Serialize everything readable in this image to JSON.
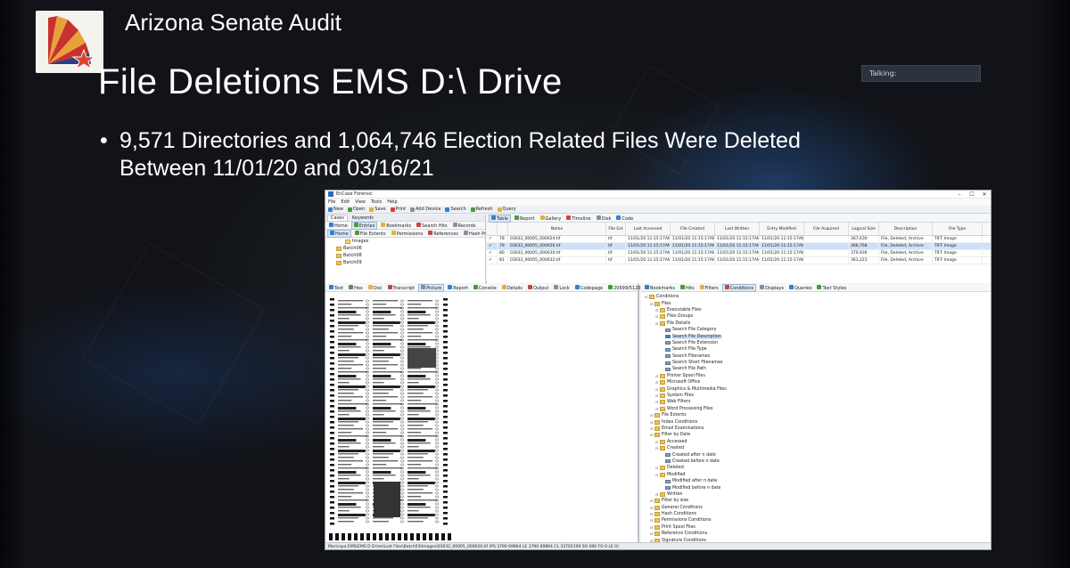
{
  "slide": {
    "org_title": "Arizona Senate Audit",
    "title": "File Deletions EMS D:\\ Drive",
    "bullet_symbol": "•",
    "bullet_line1": "9,571 Directories and 1,064,746 Election Related Files Were Deleted",
    "bullet_line2": "Between 11/01/20 and 03/16/21",
    "talking_label": "Talking:",
    "logo_colors": {
      "red": "#c8312f",
      "gold": "#e8a13a",
      "blue": "#2a3f86",
      "star": "#d9442b"
    }
  },
  "app": {
    "title": "EnCase Forensic",
    "window_controls": [
      "–",
      "☐",
      "✕"
    ],
    "menu": [
      "File",
      "Edit",
      "View",
      "Tools",
      "Help"
    ],
    "toolbar": [
      {
        "label": "New",
        "icon": "new-icon"
      },
      {
        "label": "Open",
        "icon": "open-icon"
      },
      {
        "label": "Save",
        "icon": "save-icon"
      },
      {
        "label": "Print",
        "icon": "print-icon"
      },
      {
        "label": "Add Device",
        "icon": "add-device-icon"
      },
      {
        "label": "Search",
        "icon": "search-icon"
      },
      {
        "label": "Refresh",
        "icon": "refresh-icon"
      },
      {
        "label": "Query",
        "icon": "query-icon"
      }
    ],
    "left_pane": {
      "tabs": [
        "Cases",
        "Keywords"
      ],
      "subtabs": [
        "Home",
        "Entries",
        "Bookmarks",
        "Search Hits",
        "Records"
      ],
      "filter_tabs": [
        "Home",
        "File Extents",
        "Permissions",
        "References",
        "Hash Pr"
      ],
      "tree": [
        "Images",
        "Batch06",
        "Batch08",
        "Batch09"
      ]
    },
    "right_pane": {
      "tabs": [
        "Table",
        "Report",
        "Gallery",
        "Timeline",
        "Disk",
        "Code"
      ],
      "columns": [
        "",
        "",
        "Name",
        "File Ext",
        "Last Accessed",
        "File Created",
        "Last Written",
        "Entry Modified",
        "File Acquired",
        "Logical Size",
        "Description",
        "File Type"
      ],
      "rows": [
        {
          "n": "78",
          "name": "03032_00005_000024.tif",
          "ext": "tif",
          "acc": "11/01/20 11:15:17AM",
          "cre": "11/01/20 11:15:17AM",
          "wri": "11/01/20 11:15:17AM",
          "mod": "11/01/20 11:15:17AM",
          "acq": "",
          "size": "367,630",
          "desc": "File, Deleted, Archive",
          "type": "TIFF Image"
        },
        {
          "n": "79",
          "name": "03032_00005_000026.tif",
          "ext": "tif",
          "acc": "11/01/20 11:15:17AM",
          "cre": "11/01/20 11:15:17AM",
          "wri": "11/01/20 11:15:17AM",
          "mod": "11/01/20 11:15:17AM",
          "acq": "",
          "size": "366,768",
          "desc": "File, Deleted, Archive",
          "type": "TIFF Image"
        },
        {
          "n": "80",
          "name": "03032_00005_000030.tif",
          "ext": "tif",
          "acc": "11/01/20 11:15:17AM",
          "cre": "11/01/20 11:15:17AM",
          "wri": "11/01/20 11:15:17AM",
          "mod": "11/01/20 11:15:17AM",
          "acq": "",
          "size": "370,936",
          "desc": "File, Deleted, Archive",
          "type": "TIFF Image"
        },
        {
          "n": "81",
          "name": "03032_00005_000032.tif",
          "ext": "tif",
          "acc": "11/01/20 11:15:17AM",
          "cre": "11/01/20 11:15:17AM",
          "wri": "11/01/20 11:15:17AM",
          "mod": "11/01/20 11:15:17AM",
          "acq": "",
          "size": "363,221",
          "desc": "File, Deleted, Archive",
          "type": "TIFF Image"
        }
      ]
    },
    "viewer_tabs": [
      "Text",
      "Hex",
      "Doc",
      "Transcript",
      "Picture",
      "Report",
      "Console",
      "Details",
      "Output",
      "Lock",
      "Codepage",
      "20699/512066"
    ],
    "conditions_tabs": [
      "Bookmarks",
      "Hits",
      "Filters",
      "Conditions",
      "Displays",
      "Queries",
      "Text Styles"
    ],
    "conditions_tree": [
      {
        "label": "Conditions",
        "depth": 0,
        "kind": "folder"
      },
      {
        "label": "Files",
        "depth": 1,
        "kind": "folder"
      },
      {
        "label": "Executable Files",
        "depth": 2,
        "kind": "folder"
      },
      {
        "label": "Files Groups",
        "depth": 2,
        "kind": "folder"
      },
      {
        "label": "File Details",
        "depth": 2,
        "kind": "folder"
      },
      {
        "label": "Search File Category",
        "depth": 3,
        "kind": "leaf"
      },
      {
        "label": "Search File Description",
        "depth": 3,
        "kind": "leaf",
        "hl": true
      },
      {
        "label": "Search File Extension",
        "depth": 3,
        "kind": "leaf"
      },
      {
        "label": "Search File Type",
        "depth": 3,
        "kind": "leaf"
      },
      {
        "label": "Search Filenames",
        "depth": 3,
        "kind": "leaf"
      },
      {
        "label": "Search Short Filenames",
        "depth": 3,
        "kind": "leaf"
      },
      {
        "label": "Search File Path",
        "depth": 3,
        "kind": "leaf"
      },
      {
        "label": "Printer Spool Files",
        "depth": 2,
        "kind": "folder"
      },
      {
        "label": "Microsoft Office",
        "depth": 2,
        "kind": "folder"
      },
      {
        "label": "Graphics & Multimedia Files",
        "depth": 2,
        "kind": "folder"
      },
      {
        "label": "System Files",
        "depth": 2,
        "kind": "folder"
      },
      {
        "label": "Web Filters",
        "depth": 2,
        "kind": "folder"
      },
      {
        "label": "Word Processing Files",
        "depth": 2,
        "kind": "folder"
      },
      {
        "label": "File Extents",
        "depth": 1,
        "kind": "folder"
      },
      {
        "label": "Index Conditions",
        "depth": 1,
        "kind": "folder"
      },
      {
        "label": "Email Examinations",
        "depth": 1,
        "kind": "folder"
      },
      {
        "label": "Filter by Date",
        "depth": 1,
        "kind": "folder"
      },
      {
        "label": "Accessed",
        "depth": 2,
        "kind": "folder"
      },
      {
        "label": "Created",
        "depth": 2,
        "kind": "folder"
      },
      {
        "label": "Created after n date",
        "depth": 3,
        "kind": "leaf"
      },
      {
        "label": "Created before n date",
        "depth": 3,
        "kind": "leaf"
      },
      {
        "label": "Deleted",
        "depth": 2,
        "kind": "folder"
      },
      {
        "label": "Modified",
        "depth": 2,
        "kind": "folder"
      },
      {
        "label": "Modified after n date",
        "depth": 3,
        "kind": "leaf"
      },
      {
        "label": "Modified before n date",
        "depth": 3,
        "kind": "leaf"
      },
      {
        "label": "Written",
        "depth": 2,
        "kind": "folder"
      },
      {
        "label": "Filter by size",
        "depth": 1,
        "kind": "folder"
      },
      {
        "label": "General Conditions",
        "depth": 1,
        "kind": "folder"
      },
      {
        "label": "Hash Conditions",
        "depth": 1,
        "kind": "folder"
      },
      {
        "label": "Permissions Conditions",
        "depth": 1,
        "kind": "folder"
      },
      {
        "label": "Print Spool Files",
        "depth": 1,
        "kind": "folder"
      },
      {
        "label": "Reference Conditions",
        "depth": 1,
        "kind": "folder"
      },
      {
        "label": "Signature Conditions",
        "depth": 1,
        "kind": "folder"
      }
    ],
    "status": "Maricopa EMS\\EMS D Drive\\Lost Files\\Batch03\\Images\\03032_00005_000026.tif (PS 3790 69864 LE 3790 69864 CL 33702109 SO 000 FO 0 LE 0)"
  }
}
